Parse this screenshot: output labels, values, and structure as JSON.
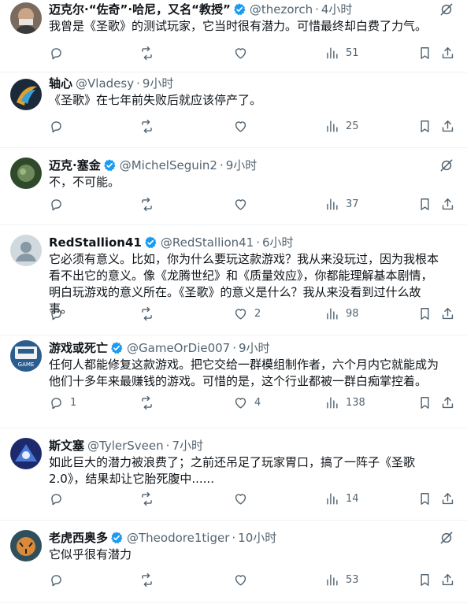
{
  "colors": {
    "text": "#0f1419",
    "muted": "#536471",
    "verified": "#1d9bf0",
    "divider": "#eff3f4"
  },
  "icons": {
    "more": "grok-slash-icon",
    "reply": "reply-icon",
    "retweet": "retweet-icon",
    "like": "heart-icon",
    "views": "views-icon",
    "bookmark": "bookmark-icon",
    "share": "share-icon"
  },
  "tweets": [
    {
      "name": "迈克尔·“佐奇”·哈尼，又名“教授”",
      "handle": "@thezorch",
      "time": "4小时",
      "text": "我曾是《圣歌》的测试玩家，它当时很有潜力。可惜最终却白费了力气。",
      "replies": "",
      "retweets": "",
      "likes": "",
      "views": "51"
    },
    {
      "name": "轴心",
      "handle": "@Vladesy",
      "time": "9小时",
      "text": "《圣歌》在七年前失败后就应该停产了。",
      "replies": "",
      "retweets": "",
      "likes": "",
      "views": "25"
    },
    {
      "name": "迈克·塞金",
      "handle": "@MichelSeguin2",
      "time": "9小时",
      "text": "不，不可能。",
      "replies": "",
      "retweets": "",
      "likes": "",
      "views": "37"
    },
    {
      "name": "RedStallion41",
      "handle": "@RedStallion41",
      "time": "6小时",
      "text": "它必须有意义。比如，你为什么要玩这款游戏？我从来没玩过，因为我根本看不出它的意义。像《龙腾世纪》和《质量效应》，你都能理解基本剧情，明白玩游戏的意义所在。《圣歌》的意义是什么？我从来没看到过什么故事。",
      "replies": "",
      "retweets": "",
      "likes": "2",
      "views": "98"
    },
    {
      "name": "游戏或死亡",
      "handle": "@GameOrDie007",
      "time": "9小时",
      "text": "任何人都能修复这款游戏。把它交给一群模组制作者，六个月内它就能成为他们十多年来最赚钱的游戏。可惜的是，这个行业都被一群白痴掌控着。",
      "replies": "1",
      "retweets": "",
      "likes": "4",
      "views": "138"
    },
    {
      "name": "斯文塞",
      "handle": "@TylerSveen",
      "time": "7小时",
      "text": "如此巨大的潜力被浪费了；之前还吊足了玩家胃口，搞了一阵子《圣歌2.0》，结果却让它胎死腹中......",
      "replies": "",
      "retweets": "",
      "likes": "",
      "views": "14"
    },
    {
      "name": "老虎西奥多",
      "handle": "@Theodore1tiger",
      "time": "10小时",
      "text": "它似乎很有潜力",
      "replies": "",
      "retweets": "",
      "likes": "",
      "views": "53"
    }
  ]
}
